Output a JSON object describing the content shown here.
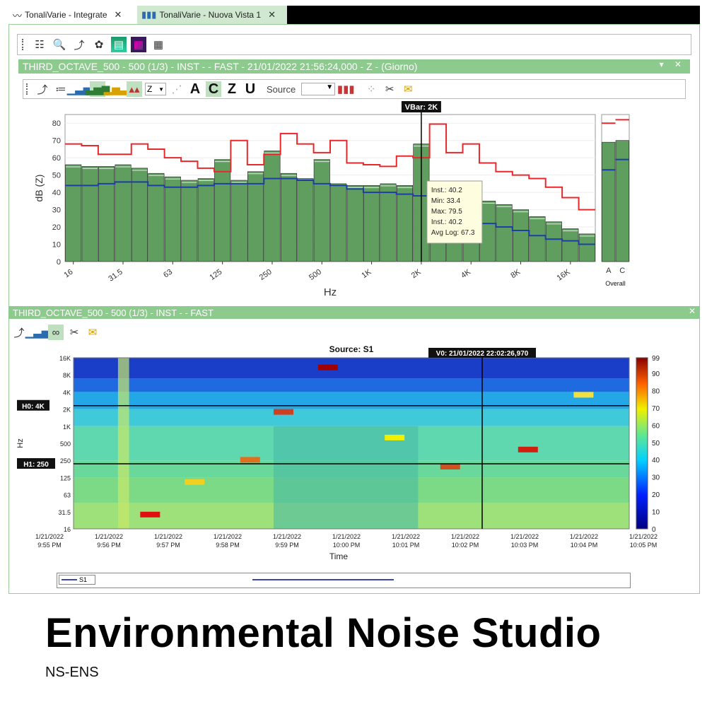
{
  "tabs": [
    {
      "label": "TonaliVarie - Integrate",
      "icon": "waveform-icon"
    },
    {
      "label": "TonaliVarie - Nuova Vista 1",
      "icon": "bar-chart-icon"
    }
  ],
  "panel1": {
    "title": "THIRD_OCTAVE_500 - 500 (1/3) - INST -  - FAST - 21/01/2022 21:56:24,000 - Z - (Giorno)"
  },
  "panel2": {
    "title": "THIRD_OCTAVE_500 - 500 (1/3) - INST -  - FAST"
  },
  "toolbar2": {
    "weighting_select": "Z",
    "weight_buttons": [
      "A",
      "C",
      "Z",
      "U"
    ],
    "source_label": "Source"
  },
  "colors": {
    "bar": "#5f9e5f",
    "max_line": "#e8282a",
    "min_line": "#1c3fa6",
    "panel_header": "#8dca8d"
  },
  "spectrum_chart": {
    "chart_data": {
      "type": "bar",
      "ylabel": "dB (Z)",
      "xlabel": "Hz",
      "ylim": [
        0,
        85
      ],
      "yticks": [
        0,
        10,
        20,
        30,
        40,
        50,
        60,
        70,
        80
      ],
      "categories": [
        "16",
        "20",
        "25",
        "31.5",
        "40",
        "50",
        "63",
        "80",
        "100",
        "125",
        "160",
        "200",
        "250",
        "315",
        "400",
        "500",
        "630",
        "800",
        "1K",
        "1.25K",
        "1.6K",
        "2K",
        "2.5K",
        "3.15K",
        "4K",
        "5K",
        "6.3K",
        "8K",
        "10K",
        "12.5K",
        "16K",
        "20K"
      ],
      "shown_ticks": [
        "16",
        "31.5",
        "63",
        "125",
        "250",
        "500",
        "1K",
        "2K",
        "4K",
        "8K",
        "16K"
      ],
      "series": [
        {
          "name": "Inst.",
          "values": [
            56,
            55,
            55,
            56,
            54,
            51,
            49,
            47,
            48,
            59,
            47,
            52,
            64,
            51,
            48,
            59,
            45,
            44,
            44,
            45,
            44,
            68,
            40,
            40,
            38,
            35,
            33,
            30,
            26,
            23,
            19,
            16
          ]
        },
        {
          "name": "Max",
          "values": [
            68,
            67,
            62,
            62,
            68,
            65,
            60,
            58,
            54,
            52,
            70,
            56,
            62,
            74,
            68,
            63,
            70,
            57,
            56,
            55,
            61,
            60,
            79.5,
            63,
            68,
            57,
            52,
            50,
            48,
            43,
            37,
            30
          ]
        },
        {
          "name": "Min",
          "values": [
            44,
            44,
            45,
            46,
            46,
            44,
            43,
            43,
            44,
            45,
            45,
            45,
            48,
            48,
            47,
            45,
            44,
            42,
            40,
            40,
            39,
            38,
            34,
            28,
            25,
            22,
            20,
            18,
            15,
            13,
            12,
            10
          ]
        }
      ],
      "overall": {
        "categories": [
          "A",
          "C"
        ],
        "label": "Overall",
        "values": [
          69,
          70
        ],
        "max": [
          80,
          82
        ],
        "min": [
          53,
          59
        ]
      }
    },
    "cursor": {
      "label": "VBar: 2K"
    },
    "tooltip": {
      "lines": [
        "Inst.: 40.2",
        "Min: 33.4",
        "Max: 79.5",
        "Inst.: 40.2",
        "Avg Log: 67.3"
      ]
    }
  },
  "spectrogram": {
    "chart_data": {
      "type": "heatmap",
      "title": "Source: S1",
      "xlabel": "Time",
      "ylabel": "Hz",
      "yticks": [
        "16K",
        "8K",
        "4K",
        "2K",
        "1K",
        "500",
        "250",
        "125",
        "63",
        "31.5",
        "16"
      ],
      "xticks": [
        [
          "1/21/2022",
          "9:55 PM"
        ],
        [
          "1/21/2022",
          "9:56 PM"
        ],
        [
          "1/21/2022",
          "9:57 PM"
        ],
        [
          "1/21/2022",
          "9:58 PM"
        ],
        [
          "1/21/2022",
          "9:59 PM"
        ],
        [
          "1/21/2022",
          "10:00 PM"
        ],
        [
          "1/21/2022",
          "10:01 PM"
        ],
        [
          "1/21/2022",
          "10:02 PM"
        ],
        [
          "1/21/2022",
          "10:03 PM"
        ],
        [
          "1/21/2022",
          "10:04 PM"
        ],
        [
          "1/21/2022",
          "10:05 PM"
        ]
      ],
      "colorbar_ticks": [
        0,
        10,
        20,
        30,
        40,
        50,
        60,
        70,
        80,
        90,
        99
      ]
    },
    "cursor_v": "V0: 21/01/2022 22:02:26,970",
    "cursor_h0": "H0: 4K",
    "cursor_h1": "H1: 250"
  },
  "legend": {
    "series": "S1"
  },
  "branding": {
    "title": "Environmental Noise Studio",
    "code": "NS-ENS"
  }
}
